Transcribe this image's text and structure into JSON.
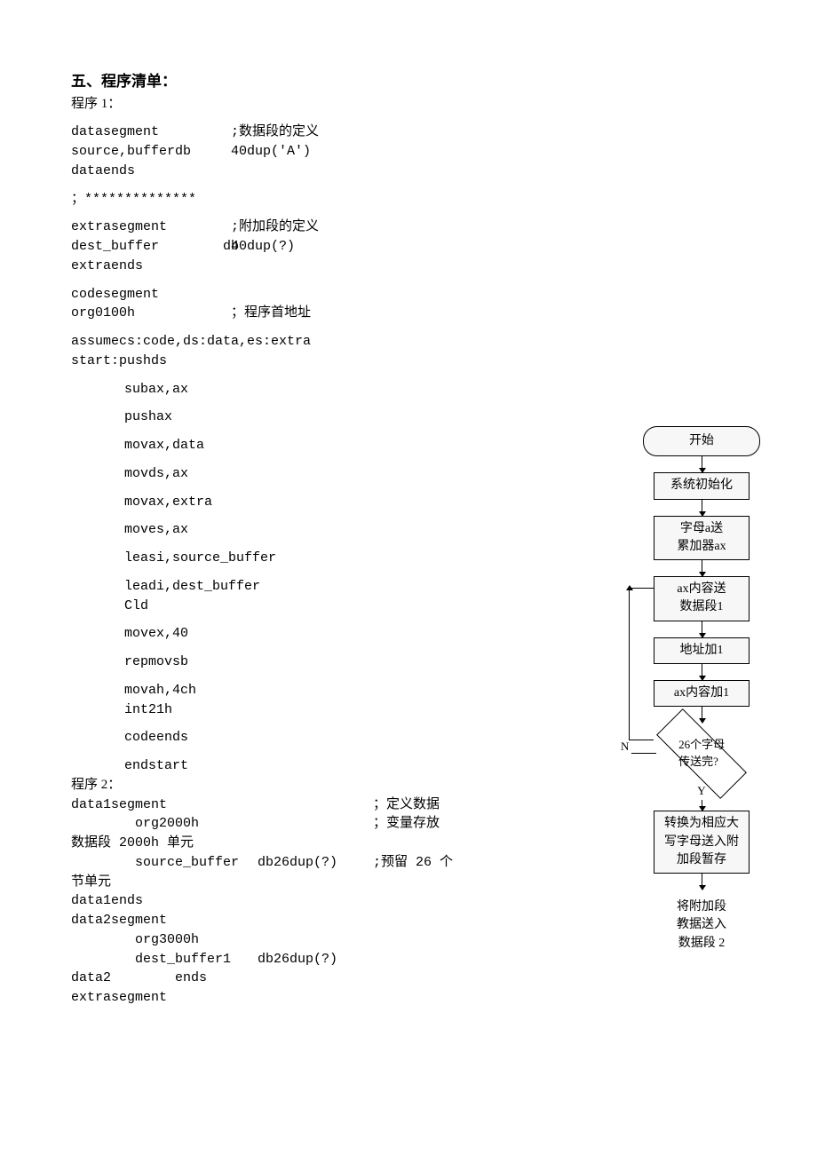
{
  "title": "五、程序清单：",
  "program1_label": "程序 1：",
  "program2_label": "程序 2：",
  "p1": {
    "l1a": "datasegment",
    "l1b": ";数据段的定义",
    "l2a": "source,bufferdb",
    "l2b": "40dup('A')",
    "l3a": "dataends",
    "sep": "；**************",
    "l4a": "extrasegment",
    "l4b": ";附加段的定义",
    "l5a": "dest_buffer        db",
    "l5b": "40dup(?)",
    "l6a": "extraends",
    "l7a": "codesegment",
    "l8a": "org0100h",
    "l8b": "；程序首地址",
    "l9": "assumecs:code,ds:data,es:extra",
    "l10": "start:pushds",
    "i1": "subax,ax",
    "i2": "pushax",
    "i3": "movax,data",
    "i4": "movds,ax",
    "i5": "movax,extra",
    "i6": "moves,ax",
    "i7": "leasi,source_buffer",
    "i8": "leadi,dest_buffer",
    "i9": "Cld",
    "i10": "movex,40",
    "i11": "repmovsb",
    "i12": "movah,4ch",
    "i13": "int21h",
    "i14": "codeends",
    "i15": "endstart"
  },
  "p2": {
    "r1a": "data1segment",
    "r1b": "；定义数据",
    "r2a": "        org2000h",
    "r2b": "；变量存放",
    "r3": "数据段 2000h 单元",
    "r4a": "        source_buffer",
    "r4b": "db26dup(?)",
    "r4c": ";预留 26 个",
    "r5": "节单元",
    "r6": "data1ends",
    "r7": "data2segment",
    "r8": "        org3000h",
    "r9a": "        dest_buffer1",
    "r9b": "db26dup(?)",
    "r10": "data2        ends",
    "r11": "extrasegment"
  },
  "flow": {
    "start": "开始",
    "s1": "系统初始化",
    "s2a": "字母a送",
    "s2b": "累加器ax",
    "s3a": "ax内容送",
    "s3b": "数据段1",
    "s4": "地址加1",
    "s5": "ax内容加1",
    "dec1": "26个字母",
    "dec2": "传送完?",
    "n": "N",
    "y": "Y",
    "s6a": "转换为相应大",
    "s6b": "写字母送入附",
    "s6c": "加段暂存",
    "final1": "将附加段",
    "final2": "教据送入",
    "final3": "数据段 2"
  }
}
